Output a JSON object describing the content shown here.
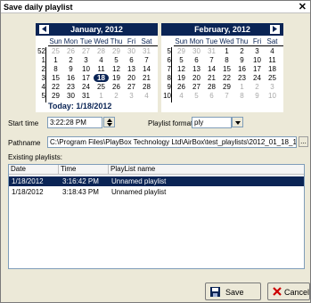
{
  "window": {
    "title": "Save daily playlist"
  },
  "calendar_left": {
    "month_label": "January, 2012",
    "dow": [
      "Sun",
      "Mon",
      "Tue",
      "Wed",
      "Thu",
      "Fri",
      "Sat"
    ],
    "weeks": [
      "52",
      "1",
      "2",
      "3",
      "4",
      "5"
    ],
    "days": [
      [
        "25",
        "26",
        "27",
        "28",
        "29",
        "30",
        "31"
      ],
      [
        "1",
        "2",
        "3",
        "4",
        "5",
        "6",
        "7"
      ],
      [
        "8",
        "9",
        "10",
        "11",
        "12",
        "13",
        "14"
      ],
      [
        "15",
        "16",
        "17",
        "18",
        "19",
        "20",
        "21"
      ],
      [
        "22",
        "23",
        "24",
        "25",
        "26",
        "27",
        "28"
      ],
      [
        "29",
        "30",
        "31",
        "1",
        "2",
        "3",
        "4"
      ]
    ],
    "today_label": "Today: 1/18/2012"
  },
  "calendar_right": {
    "month_label": "February, 2012",
    "dow": [
      "Sun",
      "Mon",
      "Tue",
      "Wed",
      "Thu",
      "Fri",
      "Sat"
    ],
    "weeks": [
      "5",
      "6",
      "7",
      "8",
      "9",
      "10"
    ],
    "days": [
      [
        "29",
        "30",
        "31",
        "1",
        "2",
        "3",
        "4"
      ],
      [
        "5",
        "6",
        "7",
        "8",
        "9",
        "10",
        "11"
      ],
      [
        "12",
        "13",
        "14",
        "15",
        "16",
        "17",
        "18"
      ],
      [
        "19",
        "20",
        "21",
        "22",
        "23",
        "24",
        "25"
      ],
      [
        "26",
        "27",
        "28",
        "29",
        "1",
        "2",
        "3"
      ],
      [
        "4",
        "5",
        "6",
        "7",
        "8",
        "9",
        "10"
      ]
    ]
  },
  "form": {
    "start_time_label": "Start time",
    "start_time_value": "3:22:28 PM",
    "playlist_format_label": "Playlist format",
    "playlist_format_value": "ply",
    "pathname_label": "Pathname",
    "pathname_value": "C:\\Program Files\\PlayBox Technology Ltd\\AirBox\\test_playlists\\2012_01_18_15_22_",
    "browse_label": "...",
    "existing_label": "Existing playlists:"
  },
  "table": {
    "columns": [
      "Date",
      "Time",
      "PlayList name"
    ],
    "rows": [
      [
        "1/18/2012",
        "3:16:42 PM",
        "Unnamed playlist"
      ],
      [
        "1/18/2012",
        "3:18:43 PM",
        "Unnamed playlist"
      ]
    ]
  },
  "buttons": {
    "save": "Save",
    "cancel": "Cancel"
  },
  "colors": {
    "accent": "#0a2455",
    "cancel_icon": "#cc0000"
  }
}
